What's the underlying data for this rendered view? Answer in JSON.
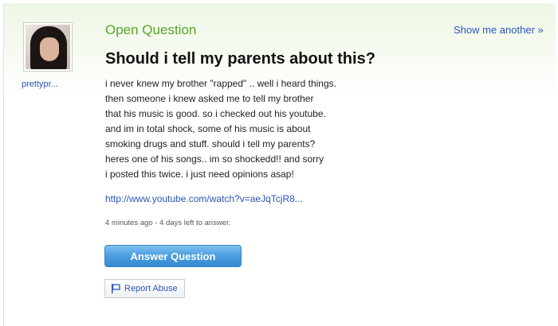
{
  "user": {
    "name": "prettypr..."
  },
  "question": {
    "status_label": "Open Question",
    "title": "Should i tell my parents about this?",
    "body_lines": [
      "i never knew my brother \"rapped\" .. well i heard things.",
      "then someone i knew asked me to tell my brother",
      "that his music is good. so i checked out his youtube.",
      "and im in total shock, some of his music is about",
      "smoking drugs and stuff. should i tell my parents?",
      "heres one of his songs.. im so shockedd!! and sorry",
      "i posted this twice. i just need opinions asap!"
    ],
    "link": "http://www.youtube.com/watch?v=aeJqTcjR8...",
    "meta": "4 minutes ago - 4 days left to answer."
  },
  "actions": {
    "show_another": "Show me another »",
    "answer": "Answer Question",
    "report": "Report Abuse"
  },
  "colors": {
    "accent_green": "#58a426",
    "link_blue": "#2a56b8",
    "button_blue": "#4ea0e0"
  }
}
